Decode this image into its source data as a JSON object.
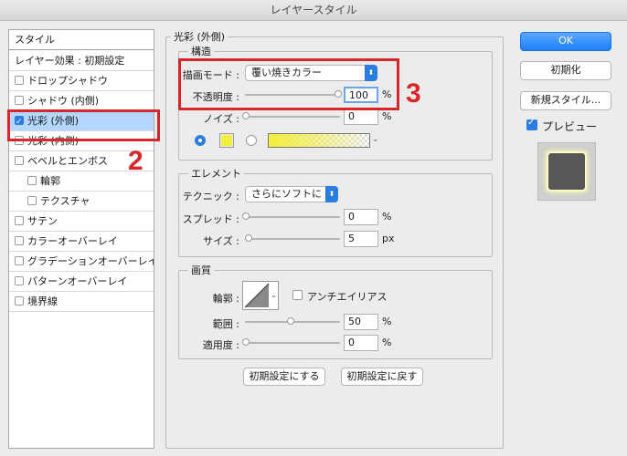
{
  "window": {
    "title": "レイヤースタイル"
  },
  "left": {
    "header": "スタイル",
    "items": [
      {
        "label": "レイヤー効果 : 初期設定",
        "checkbox": false,
        "checked": false,
        "indent": 0
      },
      {
        "label": "ドロップシャドウ",
        "checkbox": true,
        "checked": false,
        "indent": 0
      },
      {
        "label": "シャドウ (内側)",
        "checkbox": true,
        "checked": false,
        "indent": 0
      },
      {
        "label": "光彩 (外側)",
        "checkbox": true,
        "checked": true,
        "indent": 0,
        "selected": true
      },
      {
        "label": "光彩 (内側)",
        "checkbox": true,
        "checked": false,
        "indent": 0
      },
      {
        "label": "ベベルとエンボス",
        "checkbox": true,
        "checked": false,
        "indent": 0
      },
      {
        "label": "輪郭",
        "checkbox": true,
        "checked": false,
        "indent": 1
      },
      {
        "label": "テクスチャ",
        "checkbox": true,
        "checked": false,
        "indent": 1
      },
      {
        "label": "サテン",
        "checkbox": true,
        "checked": false,
        "indent": 0
      },
      {
        "label": "カラーオーバーレイ",
        "checkbox": true,
        "checked": false,
        "indent": 0
      },
      {
        "label": "グラデーションオーバーレイ",
        "checkbox": true,
        "checked": false,
        "indent": 0
      },
      {
        "label": "パターンオーバーレイ",
        "checkbox": true,
        "checked": false,
        "indent": 0
      },
      {
        "label": "境界線",
        "checkbox": true,
        "checked": false,
        "indent": 0
      }
    ]
  },
  "main": {
    "section_title": "光彩 (外側)",
    "structure": {
      "title": "構造",
      "blend_label": "描画モード :",
      "blend_value": "覆い焼きカラー",
      "opacity_label": "不透明度 :",
      "opacity_value": "100",
      "opacity_unit": "%",
      "noise_label": "ノイズ :",
      "noise_value": "0",
      "noise_unit": "%",
      "color_swatch": "#f2ee3c"
    },
    "elements": {
      "title": "エレメント",
      "technique_label": "テクニック :",
      "technique_value": "さらにソフトに",
      "spread_label": "スプレッド :",
      "spread_value": "0",
      "spread_unit": "%",
      "size_label": "サイズ :",
      "size_value": "5",
      "size_unit": "px"
    },
    "quality": {
      "title": "画質",
      "contour_label": "輪郭 :",
      "antialias_label": "アンチエイリアス",
      "range_label": "範囲 :",
      "range_value": "50",
      "range_unit": "%",
      "jitter_label": "適用度 :",
      "jitter_value": "0",
      "jitter_unit": "%"
    },
    "buttons": {
      "make_default": "初期設定にする",
      "reset_default": "初期設定に戻す"
    }
  },
  "right": {
    "ok": "OK",
    "reset": "初期化",
    "new_style": "新規スタイル...",
    "preview_label": "プレビュー"
  },
  "annotations": {
    "num2": "2",
    "num3": "3"
  }
}
